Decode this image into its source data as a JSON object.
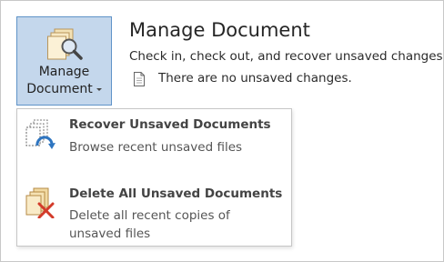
{
  "manage_button": {
    "line1": "Manage",
    "line2": "Document"
  },
  "panel": {
    "title": "Manage Document",
    "subtitle": "Check in, check out, and recover unsaved changes.",
    "status": "There are no unsaved changes."
  },
  "menu": {
    "items": [
      {
        "title": "Recover Unsaved Documents",
        "description": "Browse recent unsaved files",
        "icon": "recover-documents-icon"
      },
      {
        "title": "Delete All Unsaved Documents",
        "description": "Delete all recent copies of unsaved files",
        "icon": "delete-documents-icon"
      }
    ]
  },
  "colors": {
    "button_bg": "#c4d7ec",
    "button_border": "#5f93c8",
    "text": "#262626"
  }
}
